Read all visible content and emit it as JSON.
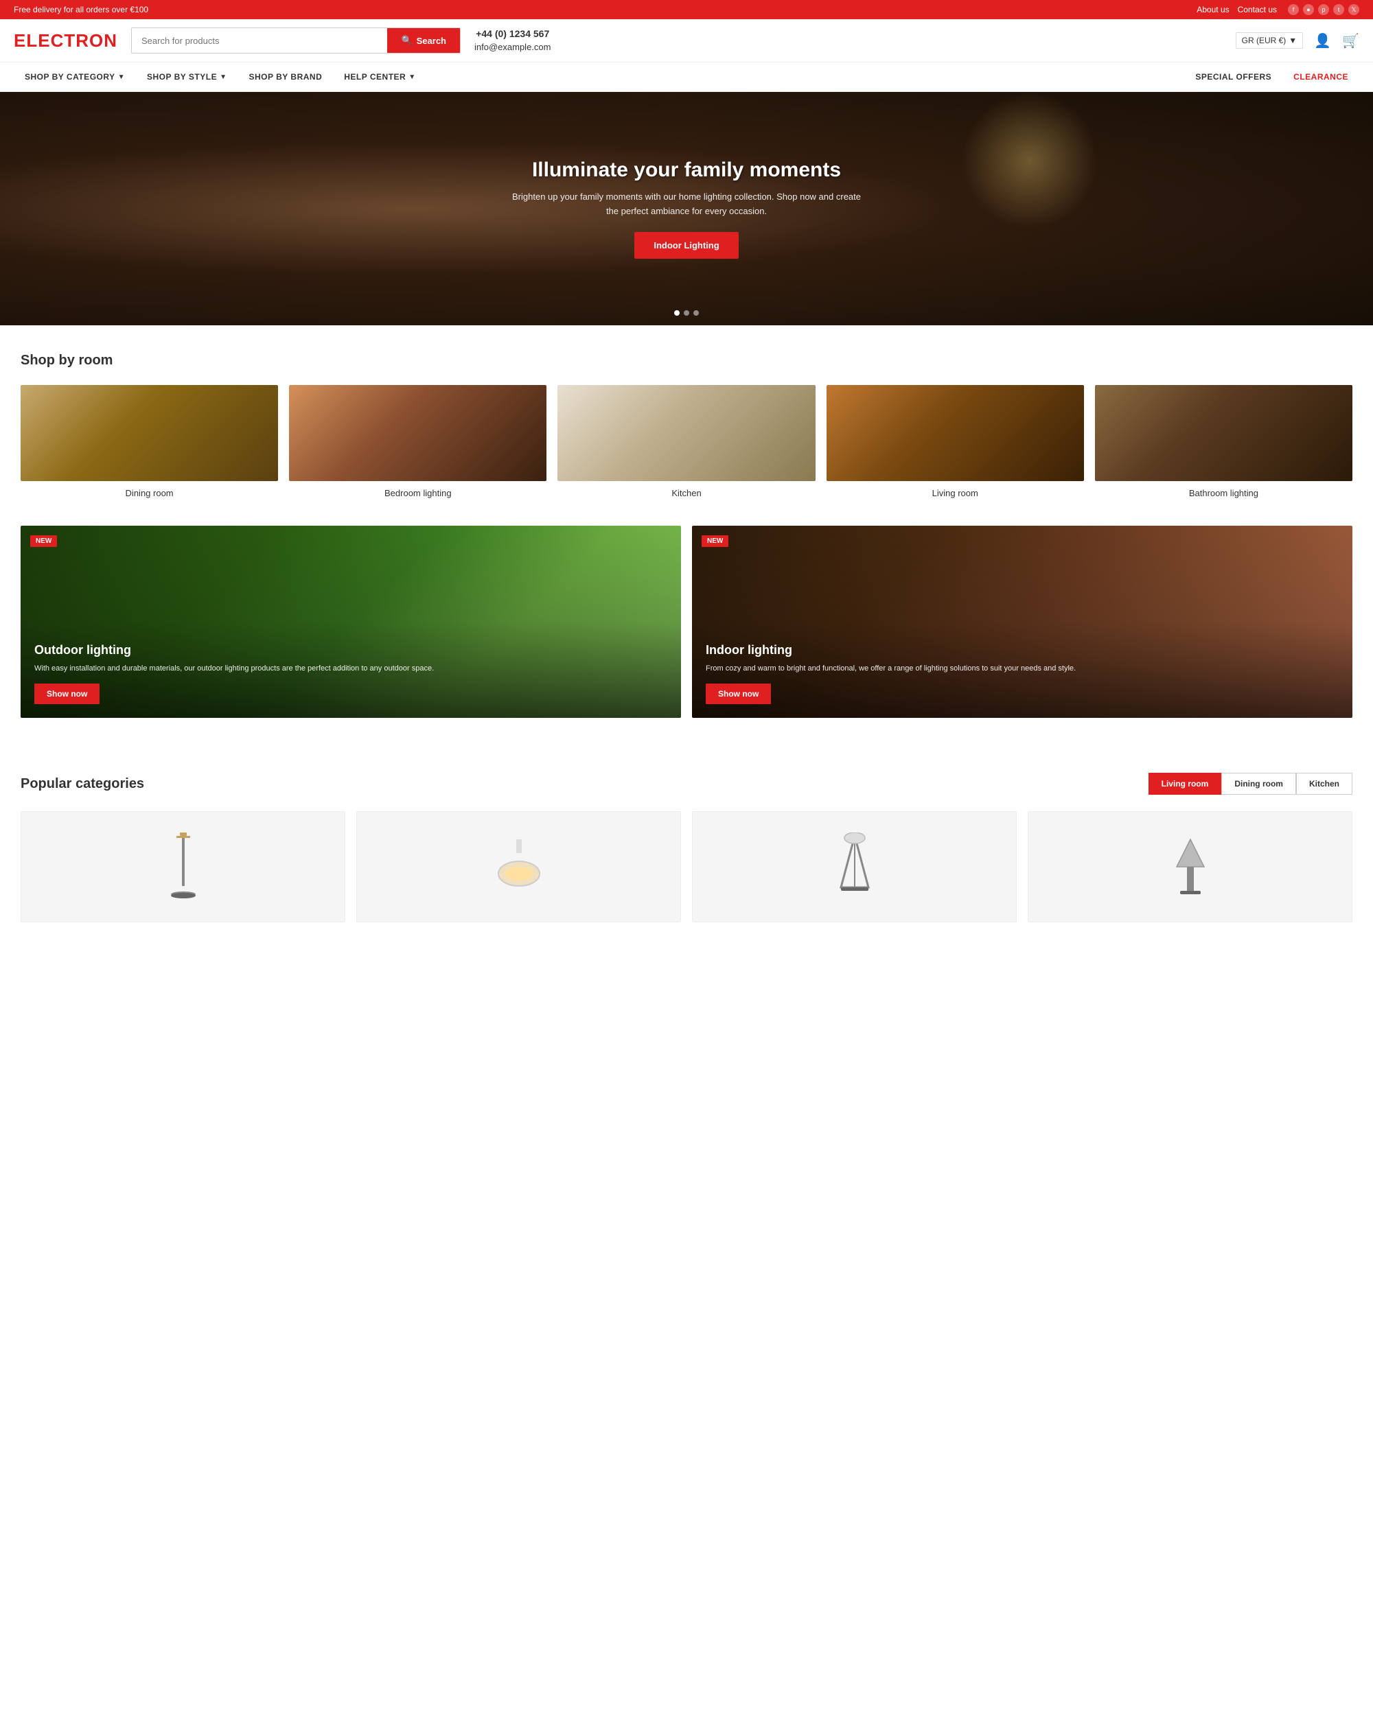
{
  "topbar": {
    "delivery_text": "Free delivery for all orders over €100",
    "links": [
      "About us",
      "Contact us"
    ],
    "social": [
      "fb",
      "ig",
      "pi",
      "tk",
      "tw"
    ]
  },
  "header": {
    "logo": "ELECTRON",
    "search_placeholder": "Search for products",
    "search_btn": "Search",
    "phone": "+44 (0) 1234 567",
    "email": "info@example.com",
    "lang": "GR (EUR €)"
  },
  "nav": {
    "left_items": [
      {
        "label": "SHOP BY CATEGORY",
        "has_dropdown": true
      },
      {
        "label": "SHOP BY STYLE",
        "has_dropdown": true
      },
      {
        "label": "SHOP BY BRAND",
        "has_dropdown": false
      },
      {
        "label": "HELP CENTER",
        "has_dropdown": true
      }
    ],
    "right_items": [
      {
        "label": "SPECIAL OFFERS",
        "class": "special"
      },
      {
        "label": "CLEARANCE",
        "class": "clearance"
      }
    ]
  },
  "hero": {
    "title": "Illuminate your family moments",
    "subtitle": "Brighten up your family moments with our home lighting collection. Shop now and create the perfect ambiance for every occasion.",
    "cta_label": "Indoor Lighting"
  },
  "shop_by_room": {
    "title": "Shop by room",
    "rooms": [
      {
        "label": "Dining room"
      },
      {
        "label": "Bedroom lighting"
      },
      {
        "label": "Kitchen"
      },
      {
        "label": "Living room"
      },
      {
        "label": "Bathroom lighting"
      }
    ]
  },
  "feature_banners": [
    {
      "tag": "NEW",
      "title": "Outdoor lighting",
      "desc": "With easy installation and durable materials, our outdoor lighting products are the perfect addition to any outdoor space.",
      "btn_label": "Show now",
      "type": "outdoor"
    },
    {
      "tag": "NEW",
      "title": "Indoor lighting",
      "desc": "From cozy and warm to bright and functional, we offer a range of lighting solutions to suit your needs and style.",
      "btn_label": "Show now",
      "type": "indoor"
    }
  ],
  "popular_categories": {
    "title": "Popular categories",
    "tabs": [
      "Living room",
      "Dining room",
      "Kitchen"
    ],
    "active_tab": 0
  }
}
